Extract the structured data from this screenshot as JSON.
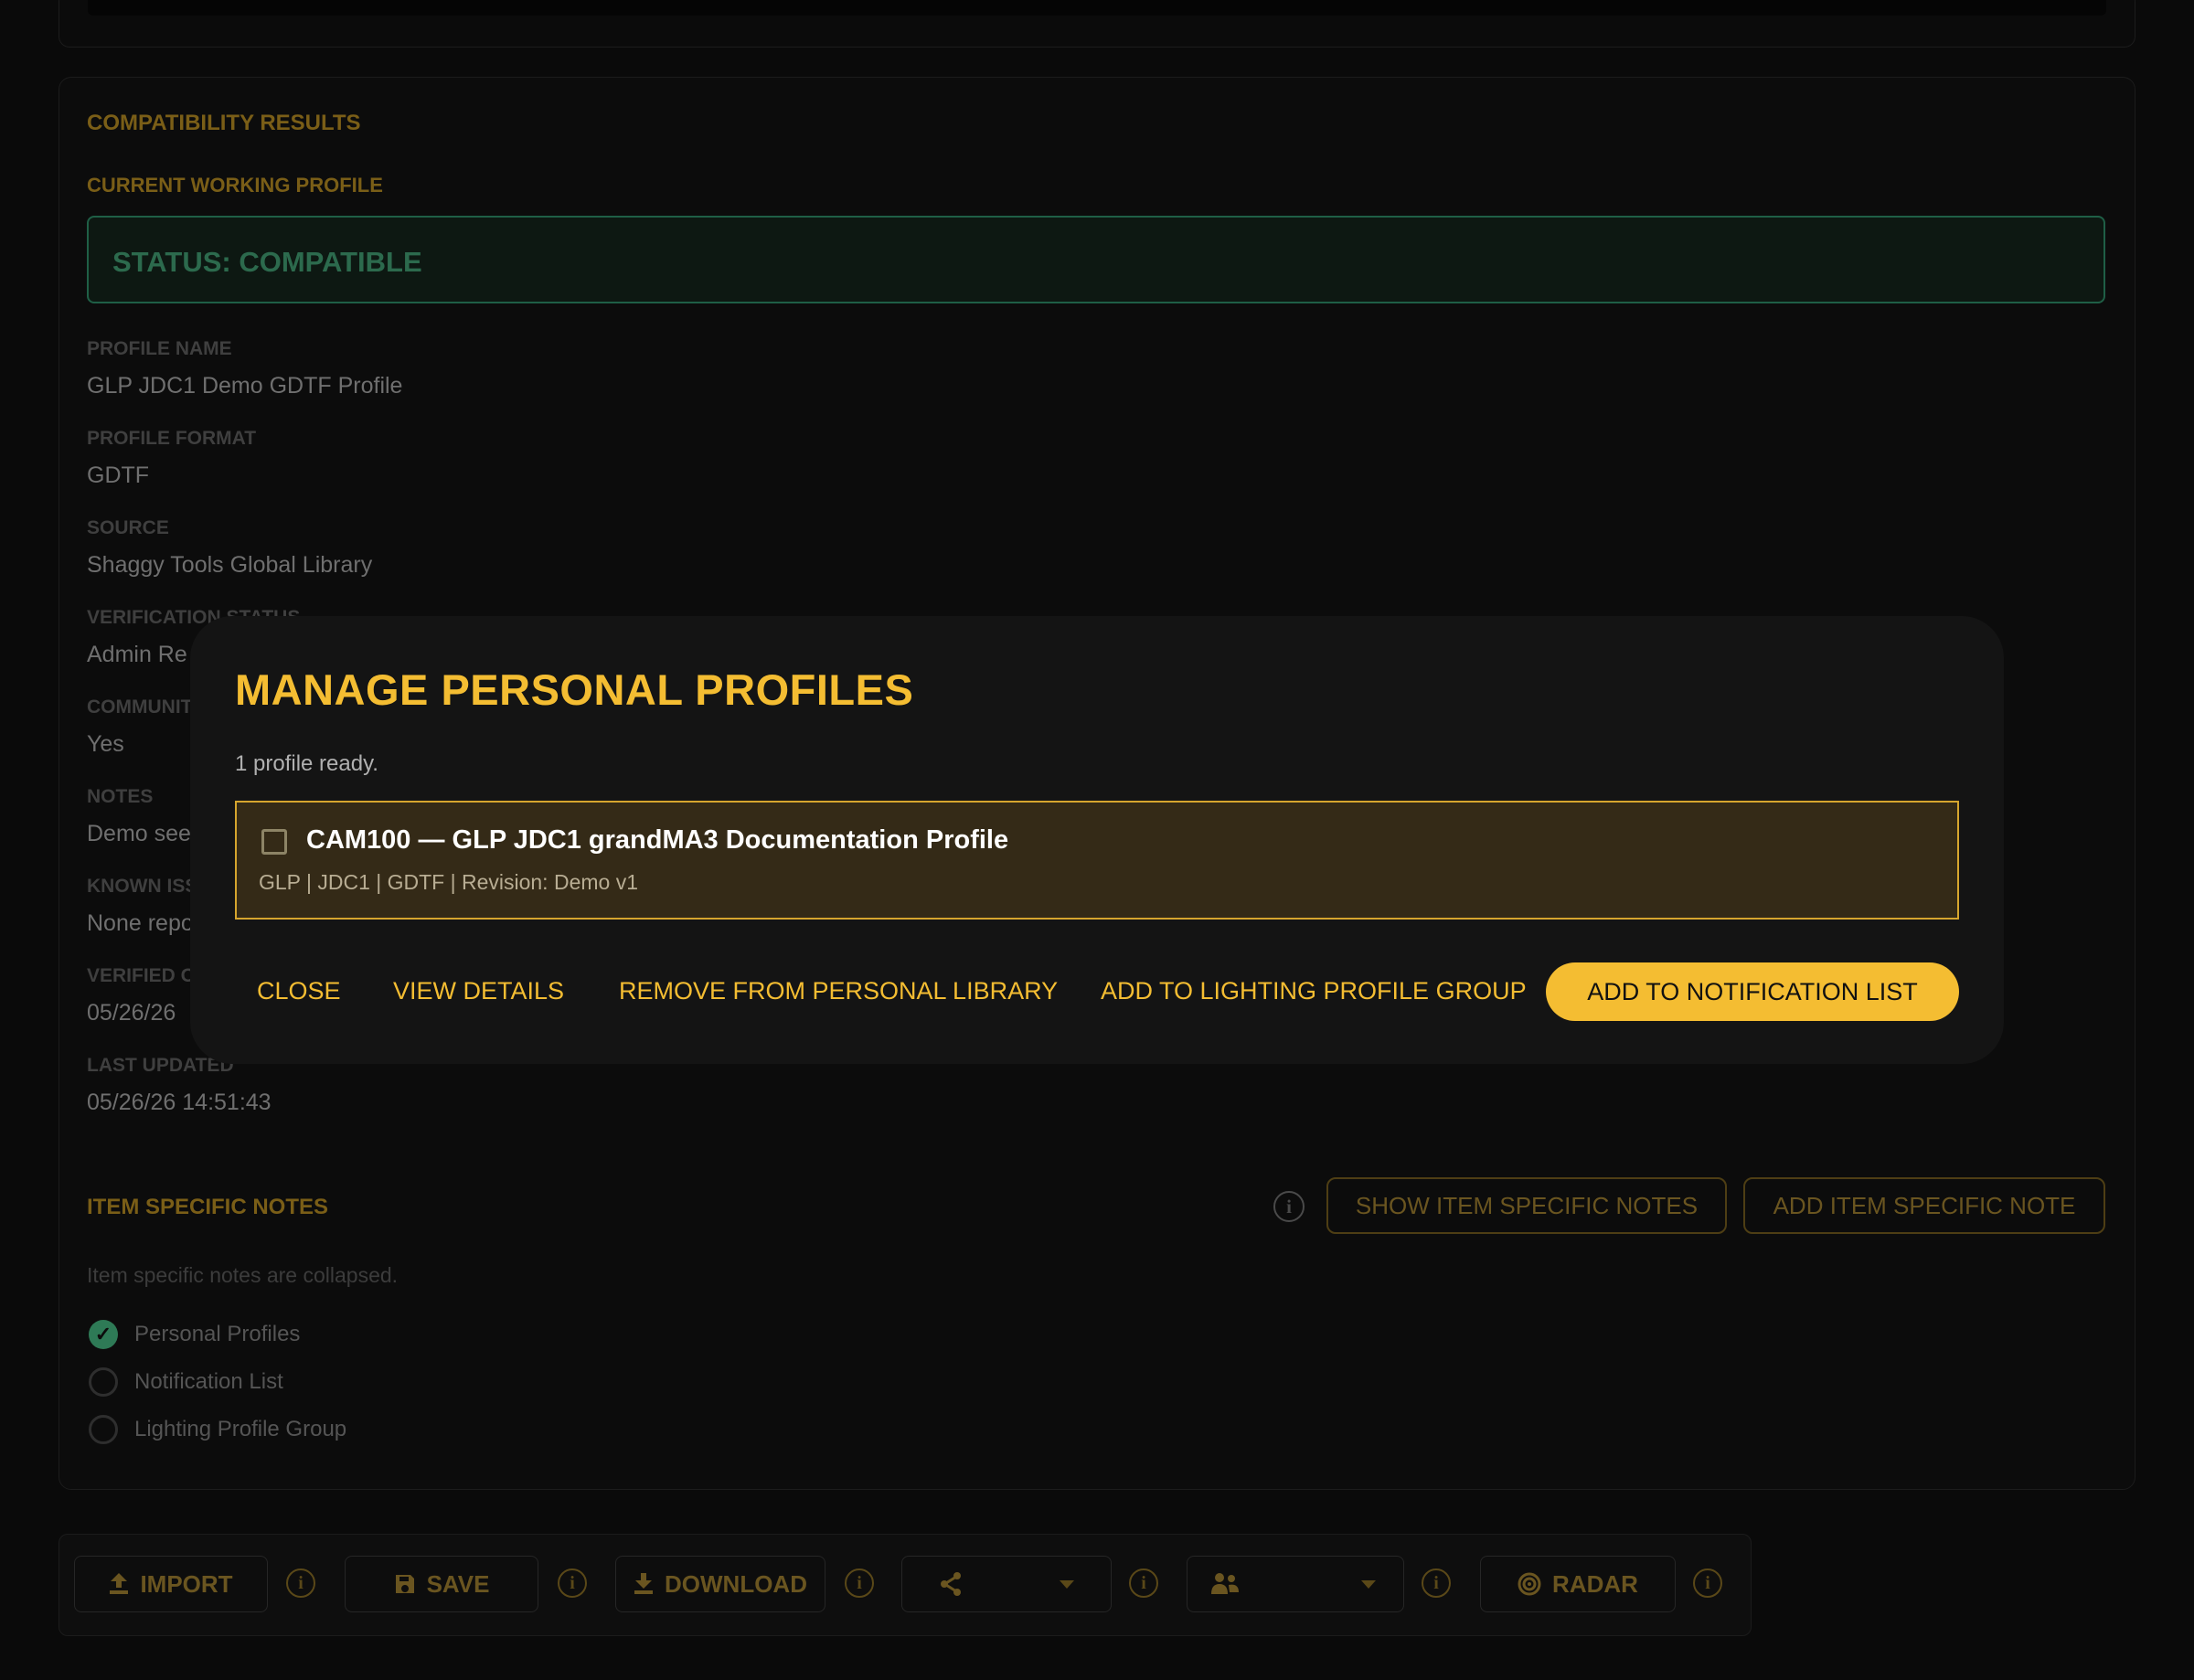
{
  "results": {
    "section_title": "COMPATIBILITY RESULTS",
    "current_profile_label": "CURRENT WORKING PROFILE",
    "status_text": "STATUS: COMPATIBLE",
    "fields": [
      {
        "label": "PROFILE NAME",
        "value": "GLP JDC1 Demo GDTF Profile"
      },
      {
        "label": "PROFILE FORMAT",
        "value": "GDTF"
      },
      {
        "label": "SOURCE",
        "value": "Shaggy Tools Global Library"
      },
      {
        "label": "VERIFICATION STATUS",
        "value": "Admin Re"
      },
      {
        "label": "COMMUNIT",
        "value": "Yes"
      },
      {
        "label": "NOTES",
        "value": "Demo see"
      },
      {
        "label": "KNOWN ISS",
        "value": "None repo"
      },
      {
        "label": "VERIFIED O",
        "value": "05/26/26"
      },
      {
        "label": "LAST UPDATED",
        "value": "05/26/26 14:51:43"
      }
    ],
    "status_color": "#2c6a4d"
  },
  "item_notes": {
    "title": "ITEM SPECIFIC NOTES",
    "show_label": "SHOW ITEM SPECIFIC NOTES",
    "add_label": "ADD ITEM SPECIFIC NOTE",
    "collapsed_hint": "Item specific notes are collapsed.",
    "checklist": [
      {
        "label": "Personal Profiles",
        "checked": true
      },
      {
        "label": "Notification List",
        "checked": false
      },
      {
        "label": "Lighting Profile Group",
        "checked": false
      }
    ]
  },
  "toolbar": {
    "import_label": "IMPORT",
    "save_label": "SAVE",
    "download_label": "DOWNLOAD",
    "radar_label": "RADAR"
  },
  "modal": {
    "title": "MANAGE PERSONAL PROFILES",
    "subtitle": "1 profile ready.",
    "profile": {
      "checked": false,
      "title": "CAM100 — GLP JDC1 grandMA3 Documentation Profile",
      "meta": "GLP | JDC1 | GDTF | Revision: Demo v1"
    },
    "actions": {
      "close": "CLOSE",
      "view_details": "VIEW DETAILS",
      "remove": "REMOVE FROM PERSONAL LIBRARY",
      "add_group": "ADD TO LIGHTING PROFILE GROUP",
      "add_notification": "ADD TO NOTIFICATION LIST"
    },
    "accent_color": "#f4bd32"
  }
}
